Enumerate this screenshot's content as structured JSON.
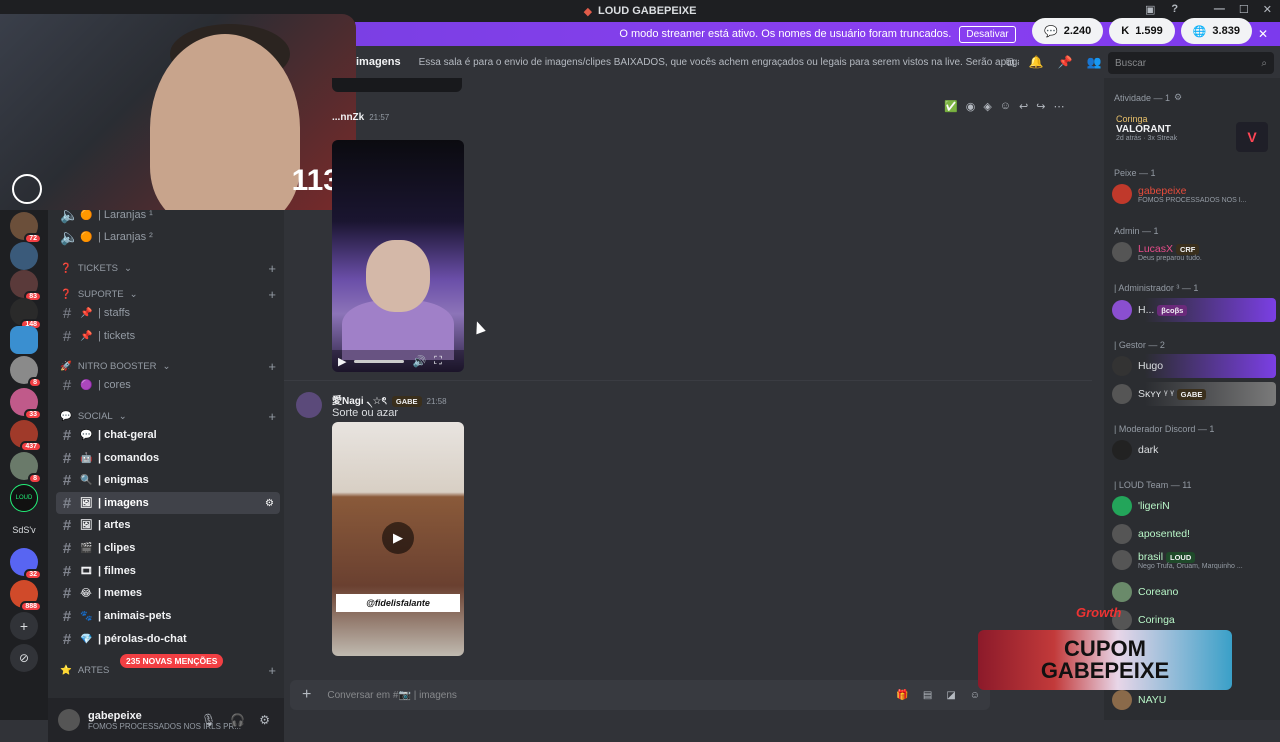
{
  "window": {
    "title": "LOUD GABEPEIXE",
    "controls": [
      "—",
      "☐",
      "✕"
    ]
  },
  "banner": {
    "text": "O modo streamer está ativo. Os nomes de usuário foram truncados.",
    "button": "Desativar",
    "close": "✕"
  },
  "stats": [
    {
      "icon": "💬",
      "value": "2.240"
    },
    {
      "icon": "K",
      "value": "1.599"
    },
    {
      "icon": "🌐",
      "value": "3.839"
    }
  ],
  "webcam": {
    "count": "113"
  },
  "header": {
    "channel": "imagens",
    "topic": "Essa sala é para o envio de imagens/clipes BAIXADOS, que vocês achem engraçados ou legais para serem vistos na live. Serão apagados prints de ou..."
  },
  "search": {
    "placeholder": "Buscar"
  },
  "servers": [
    {
      "badge": "72"
    },
    {
      "badge": ""
    },
    {
      "badge": "83"
    },
    {
      "badge": "148"
    },
    {
      "badge": ""
    },
    {
      "badge": "8"
    },
    {
      "badge": "33"
    },
    {
      "badge": "437"
    },
    {
      "badge": "8"
    },
    {
      "label": "LOUD"
    },
    {
      "label": "SdS'v"
    },
    {
      "badge": "32"
    },
    {
      "badge": "888"
    }
  ],
  "sidebar": {
    "items": [
      {
        "type": "chan",
        "emoji": "🟠",
        "label": "| Laranjas ¹"
      },
      {
        "type": "chan",
        "emoji": "🟠",
        "label": "| Laranjas ²"
      },
      {
        "type": "cat",
        "emoji": "❓",
        "label": "TICKETS"
      },
      {
        "type": "cat",
        "emoji": "❓",
        "label": "SUPORTE"
      },
      {
        "type": "chan",
        "emoji": "📌",
        "label": "| staffs"
      },
      {
        "type": "chan",
        "emoji": "📌",
        "label": "| tickets"
      },
      {
        "type": "cat",
        "emoji": "🚀",
        "label": "NITRO BOOSTER"
      },
      {
        "type": "chan",
        "emoji": "🟣",
        "label": "| cores"
      },
      {
        "type": "cat",
        "emoji": "💬",
        "label": "SOCIAL"
      },
      {
        "type": "chan",
        "emoji": "💬",
        "label": "| chat-geral"
      },
      {
        "type": "chan",
        "emoji": "🤖",
        "label": "| comandos"
      },
      {
        "type": "chan",
        "emoji": "🔍",
        "label": "| enigmas"
      },
      {
        "type": "chan",
        "emoji": "🖼",
        "label": "| imagens"
      },
      {
        "type": "chan",
        "emoji": "🖼",
        "label": "| artes"
      },
      {
        "type": "chan",
        "emoji": "🎬",
        "label": "| clipes"
      },
      {
        "type": "chan",
        "emoji": "🎞",
        "label": "| filmes"
      },
      {
        "type": "chan",
        "emoji": "😂",
        "label": "| memes"
      },
      {
        "type": "chan",
        "emoji": "🐾",
        "label": "| animais-pets"
      },
      {
        "type": "chan",
        "emoji": "💎",
        "label": "| pérolas-do-chat"
      },
      {
        "type": "cat",
        "emoji": "⭐",
        "label": "ARTES"
      }
    ],
    "mentions": "235 NOVAS MENÇÕES"
  },
  "user_panel": {
    "name": "gabepeixe",
    "status": "FOMOS PROCESSADOS NOS IRLS PR..."
  },
  "messages": [
    {
      "author": "...nnZk",
      "time": "21:57"
    },
    {
      "author": "愛Nagi ৲☆ৎ",
      "tag": "GABE",
      "time": "21:58",
      "text": "Sorte ou azar",
      "video_label": "@fidelisfalante"
    }
  ],
  "composer": {
    "placeholder": "Conversar em #📷 | imagens"
  },
  "members": {
    "activity": {
      "header": "Atividade — 1",
      "user": "Coringa",
      "game": "VALORANT",
      "detail1": "2d atrás",
      "detail2": "3x Streak"
    },
    "groups": [
      {
        "title": "Peixe — 1",
        "members": [
          {
            "name": "gabepeixe",
            "sub": "FOMOS PROCESSADOS NOS I..."
          }
        ]
      },
      {
        "title": "Admin — 1",
        "members": [
          {
            "name": "LucasX",
            "tag": "CRF",
            "sub": "Deus preparou tudo."
          }
        ]
      },
      {
        "title": "| Administrador ³ — 1",
        "members": [
          {
            "name": "H...",
            "tag": "βcoβs"
          }
        ]
      },
      {
        "title": "| Gestor — 2",
        "members": [
          {
            "name": "Hugo"
          },
          {
            "name": "Sĸʏʏ ᵞ ᵞ",
            "tag": "GABE"
          }
        ]
      },
      {
        "title": "| Moderador Discord — 1",
        "members": [
          {
            "name": "dark"
          }
        ]
      },
      {
        "title": "| LOUD Team — 11",
        "members": [
          {
            "name": "'ligeriN"
          },
          {
            "name": "aposented!"
          },
          {
            "name": "brasil",
            "tag": "LOUD",
            "sub": "Nego Trufa, Oruam, Marquinho ..."
          },
          {
            "name": "Coreano"
          },
          {
            "name": "Coringa"
          },
          {
            "name": "NAYU"
          }
        ]
      }
    ]
  },
  "promo": {
    "brand": "Growth",
    "line1": "CUPOM",
    "line2": "GABEPEIXE"
  }
}
